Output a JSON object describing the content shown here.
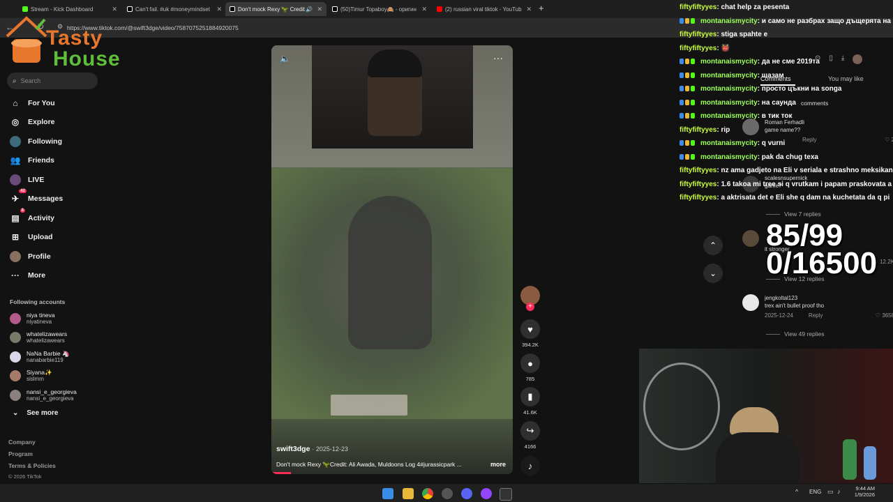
{
  "browser": {
    "tabs": [
      {
        "title": "Stream - Kick Dashboard",
        "color": "#53fc18"
      },
      {
        "title": "Can't fail. #uk #moneymindset",
        "color": "#ffffff"
      },
      {
        "title": "Don't mock Rexy 🦖 Credit",
        "color": "#ffffff"
      },
      {
        "title": "(50)Timur Topaboy🙈 - оригин",
        "color": "#ffffff"
      },
      {
        "title": "(2) russian viral tiktok - YouTub",
        "color": "#ff0000"
      }
    ],
    "url": "https://www.tiktok.com/@swift3dge/video/7587075251884920075",
    "new_tab": "+"
  },
  "overlay_logo": {
    "line1": "Tasty",
    "line2": "House"
  },
  "sidebar": {
    "search_placeholder": "Search",
    "nav": [
      {
        "label": "For You",
        "icon": "home-icon"
      },
      {
        "label": "Explore",
        "icon": "compass-icon"
      },
      {
        "label": "Following",
        "icon": "following-icon"
      },
      {
        "label": "Friends",
        "icon": "friends-icon"
      },
      {
        "label": "LIVE",
        "icon": "live-icon"
      },
      {
        "label": "Messages",
        "icon": "messages-icon",
        "badge": "42"
      },
      {
        "label": "Activity",
        "icon": "activity-icon",
        "badge": "8"
      },
      {
        "label": "Upload",
        "icon": "upload-icon"
      },
      {
        "label": "Profile",
        "icon": "profile-icon"
      },
      {
        "label": "More",
        "icon": "more-icon"
      }
    ],
    "following_heading": "Following accounts",
    "accounts": [
      {
        "name": "niya tineva",
        "handle": "niyatineva"
      },
      {
        "name": "whatelizawears",
        "handle": "whatelizawears"
      },
      {
        "name": "NaNa Barbie 🦄",
        "handle": "nanabarbie119"
      },
      {
        "name": "Siyana✨",
        "handle": "sislmm"
      },
      {
        "name": "nansi_e_georgieva",
        "handle": "nansi_e_georgieva"
      }
    ],
    "see_more": "See more",
    "footer": [
      "Company",
      "Program",
      "Terms & Policies"
    ],
    "copyright": "© 2026 TikTok"
  },
  "video": {
    "author": "swift3dge",
    "date": "· 2025-12-23",
    "caption": "Don't mock Rexy 🦖Credit: Ali Awada, Muldoons Log 4#jurassicpark ...",
    "more": "more"
  },
  "actions": {
    "likes": "394.2K",
    "comments": "785",
    "saves": "41.6K",
    "shares": "4166"
  },
  "comments_panel": {
    "tab_comments": "Comments",
    "tab_you_may_like": "You may like",
    "count_label": "comments",
    "items": [
      {
        "user": "Roman Ferhadli",
        "text": "game name?? ",
        "date": "",
        "reply": "Reply",
        "likes": "2"
      },
      {
        "user": "scalesnsupernick",
        "text": "game?",
        "date": "",
        "reply": "",
        "likes": ""
      },
      {
        "user": "jengkoltal123",
        "text": "trex ain't bullet proof tho",
        "date": "2025-12-24",
        "reply": "Reply",
        "likes": "3658"
      }
    ],
    "view_replies": [
      "View 7 replies",
      "View 12 replies",
      "View 49 replies"
    ],
    "partial_likes": "12.2K",
    "partial_text": "it stronger"
  },
  "chat": [
    {
      "user": "fiftyfiftyyes",
      "msg": ": chat help za pesenta",
      "badges": false
    },
    {
      "user": "montanaismycity",
      "msg": ": и само не разбрах защо дъщерята на",
      "badges": true
    },
    {
      "user": "fiftyfiftyyes",
      "msg": ": stiga spahte e",
      "badges": false
    },
    {
      "user": "fiftyfiftyyes",
      "msg": ": 👹",
      "badges": false
    },
    {
      "user": "montanaismycity",
      "msg": ": да не сме 2019та",
      "badges": true
    },
    {
      "user": "montanaismycity",
      "msg": ": шазам",
      "badges": true
    },
    {
      "user": "montanaismycity",
      "msg": ": просто цъкни на songa",
      "badges": true
    },
    {
      "user": "montanaismycity",
      "msg": ": на саунда",
      "badges": true
    },
    {
      "user": "montanaismycity",
      "msg": ": в тик ток",
      "badges": true
    },
    {
      "user": "fiftyfiftyyes",
      "msg": ": rip",
      "badges": false
    },
    {
      "user": "montanaismycity",
      "msg": ": q vurni",
      "badges": true
    },
    {
      "user": "montanaismycity",
      "msg": ": pak da chug texa",
      "badges": true
    },
    {
      "user": "fiftyfiftyyes",
      "msg": ": nz ama gadjeto na Eli v seriala e strashno meksikan",
      "badges": false
    },
    {
      "user": "fiftyfiftyyes",
      "msg": ": 1.6 takoa mi tree si q vrutkam i papam praskovata a",
      "badges": false
    },
    {
      "user": "fiftyfiftyyes",
      "msg": ": a aktrisata det e Eli she q dam na kuchetata da q pi",
      "badges": false
    }
  ],
  "stream_counter": {
    "line1": "85/99",
    "line2": "0/16500"
  },
  "taskbar": {
    "lang": "ENG",
    "time": "9:44 AM",
    "date": "1/9/2026"
  }
}
